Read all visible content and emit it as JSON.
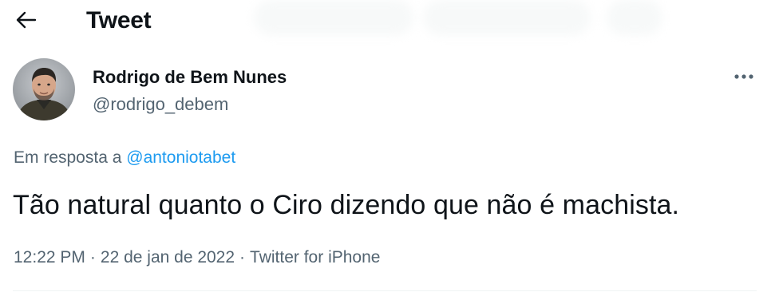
{
  "header": {
    "back_icon": "arrow-left-icon",
    "title": "Tweet"
  },
  "tweet": {
    "author": {
      "name": "Rodrigo de Bem Nunes",
      "handle": "@rodrigo_debem",
      "avatar_icon": "user-avatar-photo"
    },
    "more_icon": "more-horizontal-icon",
    "reply_prefix": "Em resposta a",
    "reply_to": "@antoniotabet",
    "text": "Tão natural quanto o Ciro dizendo que não é machista.",
    "time": "12:22 PM",
    "separator": "·",
    "date": "22 de jan de 2022",
    "source": "Twitter for iPhone"
  },
  "colors": {
    "text_primary": "#0f1419",
    "text_secondary": "#536471",
    "link": "#1d9bf0",
    "divider": "#eff3f4"
  }
}
